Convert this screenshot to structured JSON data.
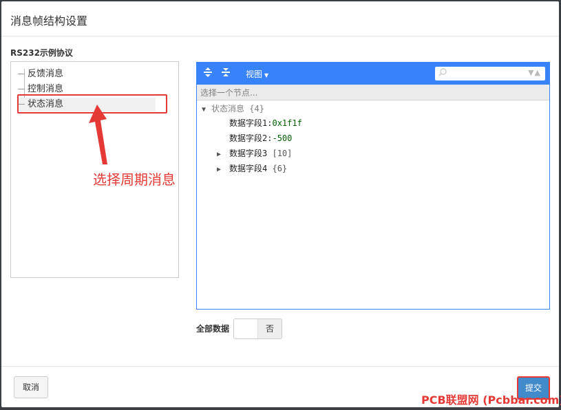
{
  "dialog": {
    "title": "消息帧结构设置",
    "protocol_label": "RS232示例协议",
    "tree": {
      "items": [
        {
          "label": "反馈消息"
        },
        {
          "label": "控制消息"
        },
        {
          "label": "状态消息",
          "selected": true
        }
      ]
    },
    "annotation": "选择周期消息",
    "editor": {
      "toolbar": {
        "expand_icon": "expand-all-icon",
        "collapse_icon": "collapse-all-icon",
        "view_label": "视图",
        "search_placeholder": ""
      },
      "nav_placeholder": "选择一个节点...",
      "root": {
        "key": "状态消息",
        "count": "{4}"
      },
      "fields": [
        {
          "key": "数据字段1",
          "colon": ":",
          "value": "0x1f1f",
          "type": "string"
        },
        {
          "key": "数据字段2",
          "colon": ":",
          "value": "-500",
          "type": "number"
        },
        {
          "key": "数据字段3",
          "count": "[10]",
          "collapsed": true
        },
        {
          "key": "数据字段4",
          "count": "{6}",
          "collapsed": true
        }
      ]
    },
    "all_data": {
      "label": "全部数据",
      "toggle_value": "否"
    },
    "footer": {
      "cancel_label": "取消",
      "submit_label": "提交"
    }
  },
  "watermark": "PCB联盟网 (Pcbbar.com)",
  "colors": {
    "accent": "#3883fa",
    "submit": "#428bca",
    "highlight": "#e53935"
  }
}
